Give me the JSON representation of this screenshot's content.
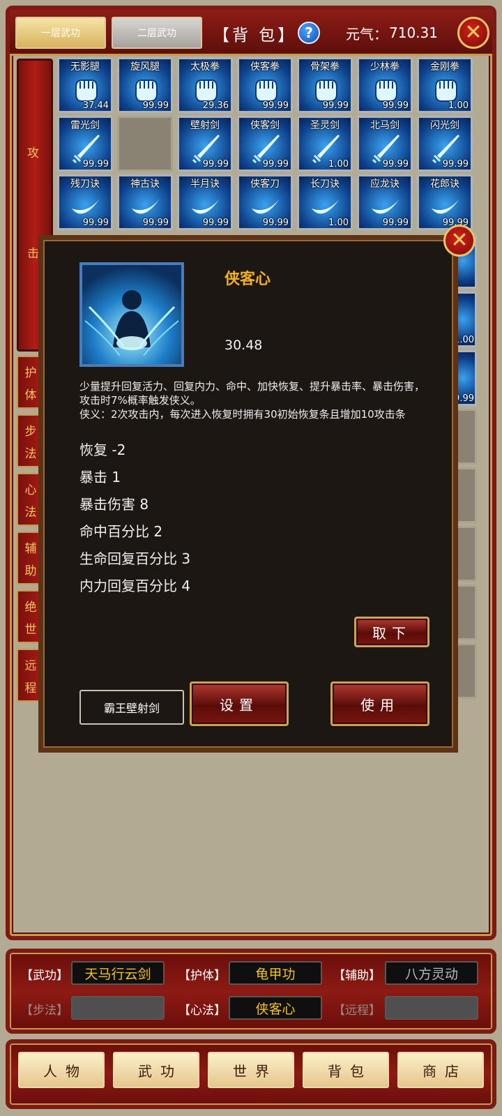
{
  "header": {
    "tab1": "一层武功",
    "tab2": "二层武功",
    "title": "【背 包】",
    "help": "?",
    "yuanqi_label": "元气：",
    "yuanqi_value": "710.31",
    "close": "✕"
  },
  "side": {
    "attack_top": "攻",
    "attack_bottom": "击",
    "buttons": [
      {
        "a": "护",
        "b": "体"
      },
      {
        "a": "步",
        "b": "法"
      },
      {
        "a": "心",
        "b": "法"
      },
      {
        "a": "辅",
        "b": "助"
      },
      {
        "a": "绝",
        "b": "世"
      },
      {
        "a": "远",
        "b": "程"
      }
    ]
  },
  "grid": {
    "row1": [
      {
        "name": "无影腿",
        "value": "37.44"
      },
      {
        "name": "旋风腿",
        "value": "99.99"
      },
      {
        "name": "太极拳",
        "value": "29.36"
      },
      {
        "name": "侠客拳",
        "value": "99.99"
      },
      {
        "name": "骨架拳",
        "value": "99.99"
      },
      {
        "name": "少林拳",
        "value": "99.99"
      },
      {
        "name": "金刚拳",
        "value": "1.00"
      }
    ],
    "row2": [
      {
        "name": "雷光剑",
        "value": "99.99"
      },
      {
        "name": "",
        "value": ""
      },
      {
        "name": "壁射剑",
        "value": "99.99"
      },
      {
        "name": "侠客剑",
        "value": "99.99"
      },
      {
        "name": "圣灵剑",
        "value": "1.00"
      },
      {
        "name": "北马剑",
        "value": "99.99"
      },
      {
        "name": "闪光剑",
        "value": "99.99"
      }
    ],
    "row3": [
      {
        "name": "残刀诀",
        "value": "99.99"
      },
      {
        "name": "神古诀",
        "value": "99.99"
      },
      {
        "name": "半月诀",
        "value": "99.99"
      },
      {
        "name": "侠客刀",
        "value": "99.99"
      },
      {
        "name": "长刀诀",
        "value": "1.00"
      },
      {
        "name": "应龙诀",
        "value": "99.99"
      },
      {
        "name": "花郎诀",
        "value": "99.99"
      }
    ],
    "right_peek": [
      "99.99",
      "1.00",
      "99.99"
    ]
  },
  "popup": {
    "name": "侠客心",
    "value": "30.48",
    "desc1": "少量提升回复活力、回复内力、命中、加快恢复、提升暴击率、暴击伤害，攻击时7%概率触发侠义。",
    "desc2": "侠义：2次攻击内，每次进入恢复时拥有30初始恢复条且增加10攻击条",
    "stats": [
      "恢复  -2",
      "暴击  1",
      "暴击伤害  8",
      "命中百分比  2",
      "生命回复百分比  3",
      "内力回复百分比  4"
    ],
    "remove_btn": "取下",
    "equip_name": "霸王壁射剑",
    "set_btn": "设置",
    "use_btn": "使用"
  },
  "equipped": {
    "wugong_label": "【武功】",
    "wugong_value": "天马行云剑",
    "huti_label": "【护体】",
    "huti_value": "龟甲功",
    "fuzhu_label": "【辅助】",
    "fuzhu_value": "八方灵动",
    "bufa_label": "【步法】",
    "bufa_value": "",
    "xinfa_label": "【心法】",
    "xinfa_value": "侠客心",
    "yuancheng_label": "【远程】",
    "yuancheng_value": ""
  },
  "nav": [
    "人物",
    "武功",
    "世界",
    "背包",
    "商店"
  ],
  "colors": {
    "frame_red": "#7d1a14",
    "gold": "#f0b020",
    "background": "#b3aa93"
  }
}
